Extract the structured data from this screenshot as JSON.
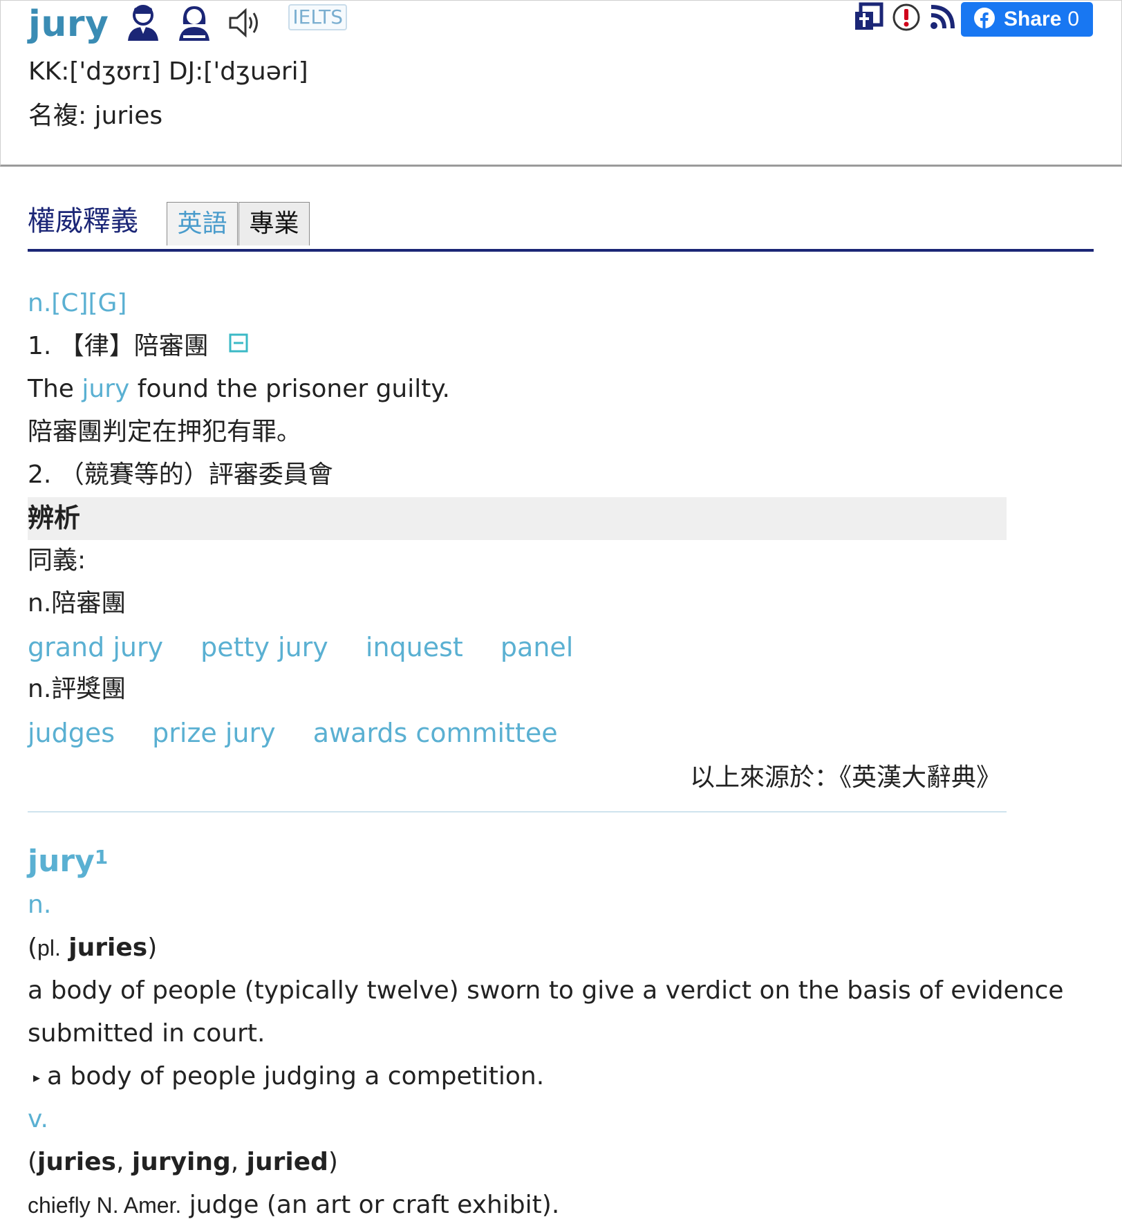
{
  "header": {
    "headword": "jury",
    "exam_tag": "IELTS",
    "phonetic": "KK:['dʒʊrɪ] DJ:['dʒuəri]",
    "plural": "名複: juries",
    "share_label": "Share",
    "share_count": "0",
    "icons": [
      "male-speaker-icon",
      "female-speaker-icon",
      "speaker-icon",
      "dictionary-icon",
      "report-icon",
      "rss-icon",
      "facebook-icon"
    ]
  },
  "section": {
    "title": "權威釋義",
    "tabs": [
      {
        "label": "英語",
        "active": true
      },
      {
        "label": "專業",
        "active": false
      }
    ]
  },
  "entry": {
    "pos": "n.[C][G]",
    "sense1": "1. 【律】陪審團",
    "example_before": "The ",
    "example_link": "jury",
    "example_after": " found the prisoner guilty.",
    "example_translation": "陪審團判定在押犯有罪。",
    "sense2": "2. （競賽等的）評審委員會"
  },
  "analysis": {
    "title": "辨析",
    "synonym_label": "同義:",
    "groups": [
      {
        "label": "n.陪審團",
        "words": [
          "grand jury",
          "petty jury",
          "inquest",
          "panel"
        ]
      },
      {
        "label": "n.評獎團",
        "words": [
          "judges",
          "prize jury",
          "awards committee"
        ]
      }
    ],
    "source": "以上來源於：《英漢大辭典》"
  },
  "oxford": {
    "headword": "jury",
    "superscript": "1",
    "noun_pos": "n.",
    "plural_prefix": "(",
    "plural_abbr": "pl.",
    "plural_word": "juries",
    "plural_suffix": ")",
    "def1_line1": "a body of people (typically twelve) sworn to give a verdict on the basis of evidence",
    "def1_line2": "submitted in court.",
    "subdef": "a body of people judging a competition.",
    "verb_pos": "v.",
    "verb_forms": [
      "juries",
      "jurying",
      "juried"
    ],
    "verb_region": "chiefly N. Amer.",
    "verb_def": "judge (an art or craft exhibit)."
  },
  "colors": {
    "accent": "#5ab0d2",
    "headword": "#3a8cb4",
    "navy": "#1b2676",
    "facebook": "#1877f2"
  }
}
